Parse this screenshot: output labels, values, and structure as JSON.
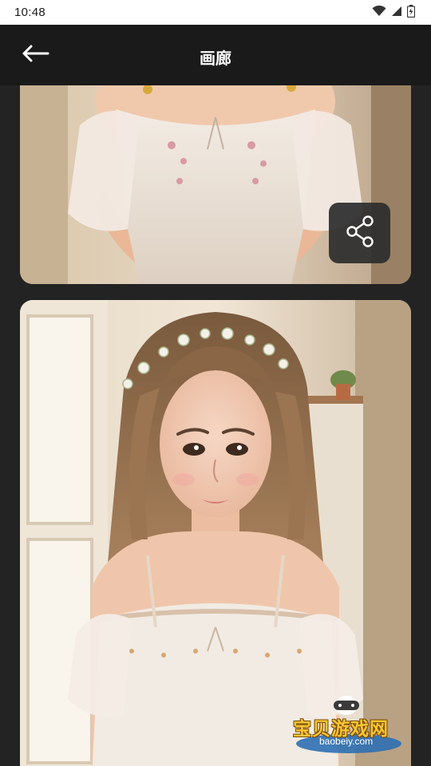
{
  "status_bar": {
    "time": "10:48",
    "icons": [
      "wifi-icon",
      "signal-icon",
      "battery-icon"
    ]
  },
  "app_bar": {
    "title": "画廊",
    "back_icon": "arrow-left-icon"
  },
  "gallery": {
    "items": [
      {
        "alt": ""
      },
      {
        "alt": ""
      }
    ],
    "share_icon": "share-icon"
  },
  "watermark": {
    "text": "宝贝游戏网",
    "sub": "baobeiy.com"
  },
  "colors": {
    "status_bg": "#ffffff",
    "app_bar_bg": "#1a1a1a",
    "gallery_bg": "#232323",
    "share_bg": "#2d2d2d"
  }
}
